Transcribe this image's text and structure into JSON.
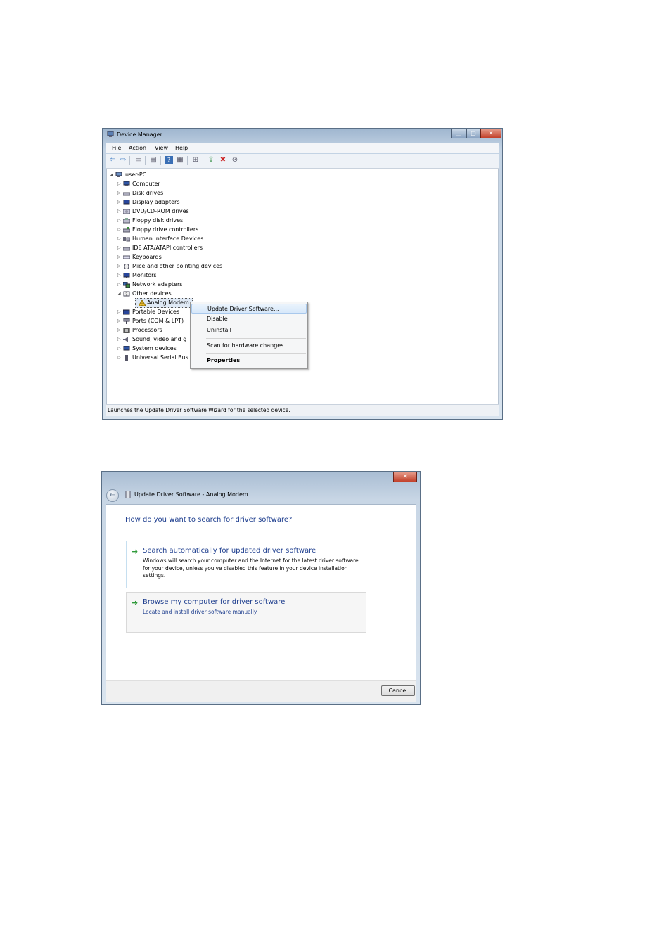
{
  "device_manager": {
    "title": "Device Manager",
    "menu": [
      "File",
      "Action",
      "View",
      "Help"
    ],
    "root": "user-PC",
    "categories": [
      {
        "label": "Computer",
        "icon": "computer-icon"
      },
      {
        "label": "Disk drives",
        "icon": "disk-drive-icon"
      },
      {
        "label": "Display adapters",
        "icon": "display-adapter-icon"
      },
      {
        "label": "DVD/CD-ROM drives",
        "icon": "dvd-drive-icon"
      },
      {
        "label": "Floppy disk drives",
        "icon": "floppy-icon"
      },
      {
        "label": "Floppy drive controllers",
        "icon": "controller-icon"
      },
      {
        "label": "Human Interface Devices",
        "icon": "hid-icon"
      },
      {
        "label": "IDE ATA/ATAPI controllers",
        "icon": "ide-icon"
      },
      {
        "label": "Keyboards",
        "icon": "keyboard-icon"
      },
      {
        "label": "Mice and other pointing devices",
        "icon": "mouse-icon"
      },
      {
        "label": "Monitors",
        "icon": "monitor-icon"
      },
      {
        "label": "Network adapters",
        "icon": "network-icon"
      },
      {
        "label": "Other devices",
        "icon": "other-devices-icon"
      },
      {
        "label": "Analog Modem",
        "icon": "warning-device-icon"
      },
      {
        "label": "Portable Devices",
        "icon": "portable-icon"
      },
      {
        "label": "Ports (COM & LPT)",
        "icon": "port-icon"
      },
      {
        "label": "Processors",
        "icon": "processor-icon"
      },
      {
        "label": "Sound, video and g",
        "icon": "sound-icon"
      },
      {
        "label": "System devices",
        "icon": "system-icon"
      },
      {
        "label": "Universal Serial Bus",
        "icon": "usb-icon"
      }
    ],
    "status": "Launches the Update Driver Software Wizard for the selected device."
  },
  "context_menu": {
    "items": [
      "Update Driver Software...",
      "Disable",
      "Uninstall",
      "Scan for hardware changes",
      "Properties"
    ]
  },
  "update_driver": {
    "title": "Update Driver Software - Analog Modem",
    "question": "How do you want to search for driver software?",
    "option1": {
      "heading": "Search automatically for updated driver software",
      "description": "Windows will search your computer and the Internet for the latest driver software for your device, unless you've disabled this feature in your device installation settings."
    },
    "option2": {
      "heading": "Browse my computer for driver software",
      "description": "Locate and install driver software manually."
    },
    "cancel": "Cancel"
  },
  "colors": {
    "accent_link": "#1f3f8f",
    "arrow_green": "#2f9a3a",
    "close_red": "#c2402a"
  }
}
